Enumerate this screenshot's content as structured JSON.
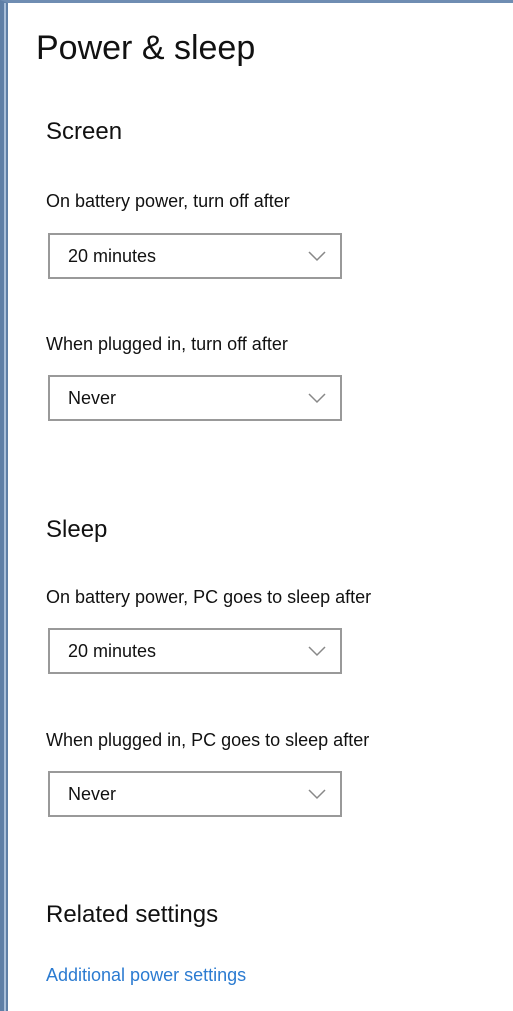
{
  "page": {
    "title": "Power & sleep"
  },
  "screen": {
    "heading": "Screen",
    "battery": {
      "label": "On battery power, turn off after",
      "value": "20 minutes"
    },
    "plugged": {
      "label": "When plugged in, turn off after",
      "value": "Never"
    }
  },
  "sleep": {
    "heading": "Sleep",
    "battery": {
      "label": "On battery power, PC goes to sleep after",
      "value": "20 minutes"
    },
    "plugged": {
      "label": "When plugged in, PC goes to sleep after",
      "value": "Never"
    }
  },
  "related": {
    "heading": "Related settings",
    "link": "Additional power settings"
  },
  "colors": {
    "link": "#2b7bd1",
    "dropdown_border": "#999999",
    "text": "#111111"
  },
  "icons": {
    "dropdown": "chevron-down-icon"
  }
}
